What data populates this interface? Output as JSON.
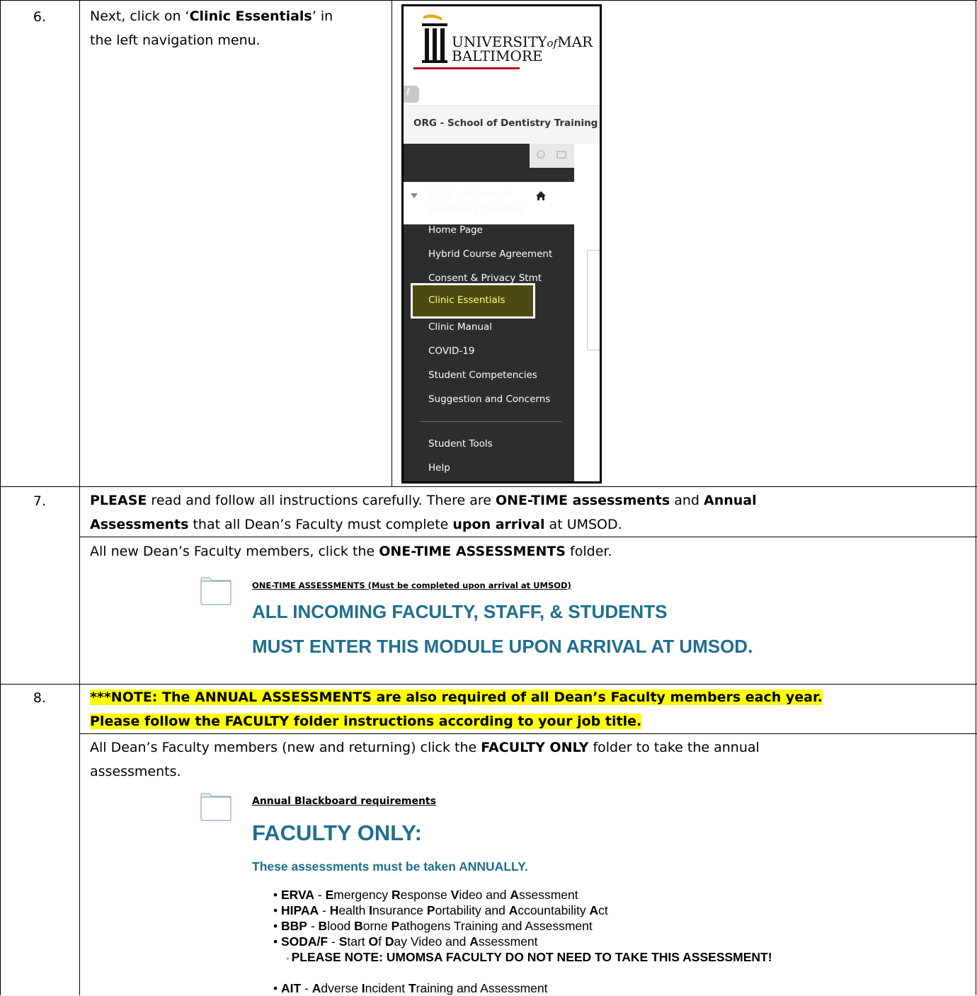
{
  "row6": {
    "number": "6.",
    "instruction_prefix": "Next, click on ‘",
    "instruction_bold": "Clinic Essentials",
    "instruction_suffix": "’ in",
    "instruction_line2": "the left navigation menu.",
    "screenshot": {
      "university_line1": "UNIVERSITY",
      "university_of": "of",
      "university_line1b": "MAR",
      "university_line2": "BALTIMORE",
      "course_title": "ORG - School of Dentistry Training",
      "course_menu_title_1": "ORG - School of",
      "course_menu_title_2": "Dentistry Training",
      "menu_items": [
        "Home Page",
        "Hybrid Course Agreement",
        "Consent & Privacy Stmt",
        "Clinic Essentials",
        "Clinic Manual",
        "COVID-19",
        "Student Competencies",
        "Suggestion and Concerns",
        "Student Tools",
        "Help"
      ]
    }
  },
  "row7": {
    "number": "7.",
    "line1_a": "PLEASE",
    "line1_b": " read and follow all instructions carefully.  There are ",
    "line1_c": "ONE-TIME assessments",
    "line1_d": " and ",
    "line1_e": "Annual",
    "line2_a": "Assessments",
    "line2_b": " that all Dean’s Faculty must complete ",
    "line2_c": "upon arrival",
    "line2_d": " at UMSOD.",
    "line3_a": "All new Dean’s Faculty members, click the ",
    "line3_b": "ONE-TIME ASSESSMENTS",
    "line3_c": " folder.",
    "folder_link": "ONE-TIME ASSESSMENTS (Must be completed upon arrival at UMSOD)",
    "folder_heading_1": "ALL INCOMING FACULTY, STAFF, & STUDENTS",
    "folder_heading_2": "MUST ENTER THIS MODULE UPON ARRIVAL AT UMSOD."
  },
  "row8": {
    "number": "8.",
    "note_line1": "***NOTE: The ANNUAL ASSESSMENTS are also required of all Dean’s Faculty members each year.",
    "note_line2": "Please follow the FACULTY folder instructions according to your job title.",
    "line3_a": "All Dean’s Faculty members (new and returning) click the ",
    "line3_b": "FACULTY ONLY",
    "line3_c": " folder to take the annual",
    "line4": "assessments.",
    "folder_link": "Annual Blackboard requirements",
    "folder_heading": "FACULTY ONLY:",
    "folder_subheading": "These assessments must be taken ANNUALLY.",
    "bullets": [
      {
        "abbr": "ERVA",
        "sep": " - ",
        "parts": [
          [
            "E",
            "mergency "
          ],
          [
            "R",
            "esponse "
          ],
          [
            "V",
            "ideo and "
          ],
          [
            "A",
            "ssessment"
          ]
        ]
      },
      {
        "abbr": "HIPAA",
        "sep": " - ",
        "parts": [
          [
            "H",
            "ealth "
          ],
          [
            "I",
            "nsurance "
          ],
          [
            "P",
            "ortability and "
          ],
          [
            "A",
            "ccountability "
          ],
          [
            "A",
            "ct"
          ]
        ]
      },
      {
        "abbr": "BBP",
        "sep": " - ",
        "parts": [
          [
            "B",
            "lood "
          ],
          [
            "B",
            "orne "
          ],
          [
            "P",
            "athogens Training and Assessment"
          ]
        ]
      },
      {
        "abbr": "SODA/F",
        "sep": " - ",
        "parts": [
          [
            "S",
            "tart "
          ],
          [
            "O",
            "f "
          ],
          [
            "D",
            "ay Video and "
          ],
          [
            "A",
            "ssessment"
          ]
        ]
      },
      {
        "abbr": "AIT",
        "sep": " - ",
        "parts": [
          [
            "A",
            "dverse "
          ],
          [
            "I",
            "ncident "
          ],
          [
            "T",
            "raining and Assessment"
          ]
        ]
      }
    ],
    "sub_bullet": "PLEASE NOTE: UMOMSA FACULTY DO NOT NEED TO TAKE THIS ASSESSMENT!"
  },
  "colors": {
    "heading_blue": "#1f6e8f",
    "highlight": "#ffff00",
    "nav_dark": "#2d2d2d"
  }
}
